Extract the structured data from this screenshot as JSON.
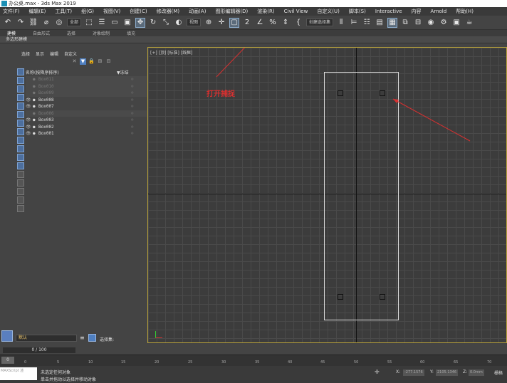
{
  "window": {
    "title": "办公桌.max - 3ds Max 2019"
  },
  "menu": [
    "文件(F)",
    "编辑(E)",
    "工具(T)",
    "组(G)",
    "视图(V)",
    "创建(C)",
    "修改器(M)",
    "动画(A)",
    "图形编辑器(D)",
    "渲染(R)",
    "Civil View",
    "自定义(U)",
    "脚本(S)",
    "Interactive",
    "内容",
    "Arnold",
    "帮助(H)"
  ],
  "toolbar": {
    "filter_value": "全部",
    "refcoord_value": "视图",
    "selset_placeholder": "创建选择集"
  },
  "ribbon": {
    "tabs": [
      "建模",
      "自由形式",
      "选择",
      "对象绘制",
      "填充"
    ],
    "sub_label": "多边形建模"
  },
  "scene_explorer": {
    "menu": [
      "选择",
      "显示",
      "编辑",
      "自定义"
    ],
    "col_name": "名称(按降序排序)",
    "col_freeze": "▼冻结",
    "rows": [
      {
        "name": "Box011",
        "hidden": true
      },
      {
        "name": "Box010",
        "hidden": true
      },
      {
        "name": "Box009",
        "hidden": true
      },
      {
        "name": "Box008",
        "hidden": false
      },
      {
        "name": "Box007",
        "hidden": false
      },
      {
        "name": "Box006",
        "hidden": true
      },
      {
        "name": "Box003",
        "hidden": false
      },
      {
        "name": "Box002",
        "hidden": false
      },
      {
        "name": "Box001",
        "hidden": false
      }
    ]
  },
  "viewport": {
    "label": "[+] [顶] [标准] [线框]"
  },
  "annotation": {
    "text": "打开捕捉"
  },
  "layer": {
    "name": "默认",
    "selset_label": "选择集:"
  },
  "frames": {
    "counter": "0 / 100",
    "slider": "0",
    "ticks": [
      "0",
      "5",
      "10",
      "15",
      "20",
      "25",
      "30",
      "35",
      "40",
      "45",
      "50",
      "55",
      "60",
      "65",
      "70"
    ]
  },
  "status": {
    "maxscript": "MAXScript 迷",
    "line1": "未选定任何对象",
    "line2": "单击并拖动以选择并移动对象",
    "x": "-277.1576",
    "y": "2105.1346",
    "z": "0.0mm",
    "grid": "栅格"
  }
}
